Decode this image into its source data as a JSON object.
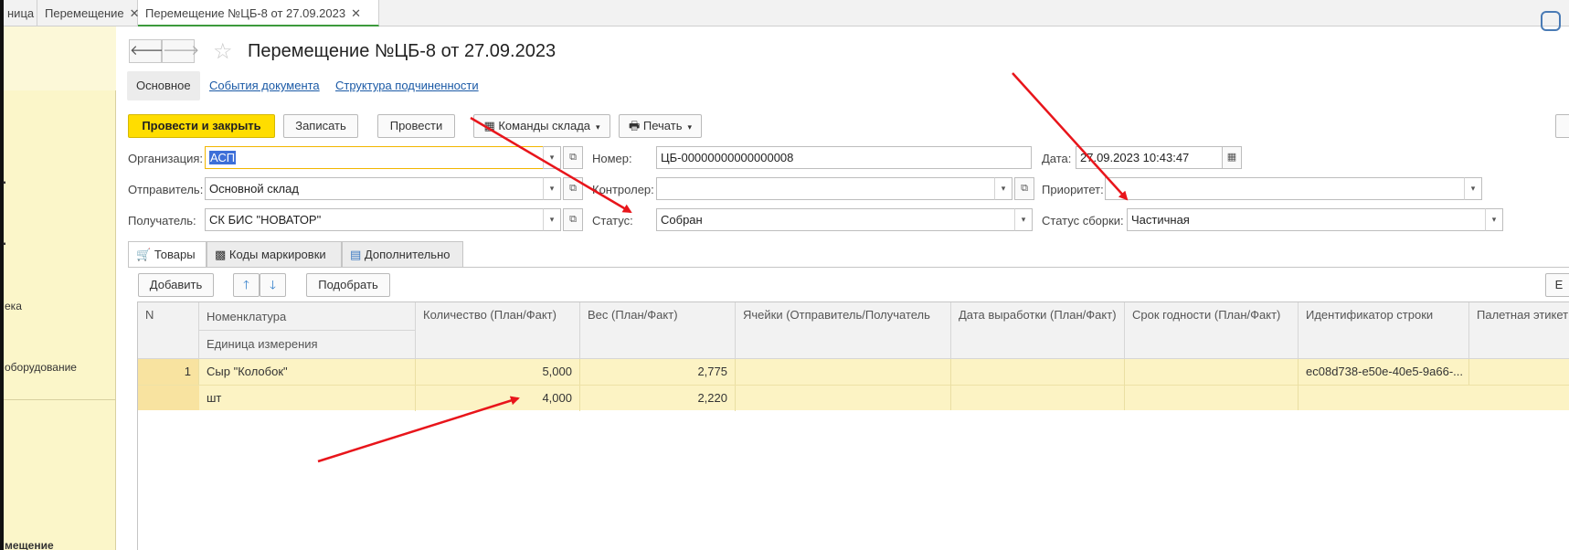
{
  "top_tabs": [
    {
      "label": "ница"
    },
    {
      "label": "Перемещение"
    },
    {
      "label": "Перемещение №ЦБ-8 от 27.09.2023"
    }
  ],
  "sidebar": {
    "items": [
      {
        "label": "ека"
      },
      {
        "label": "оборудование"
      },
      {
        "label": "мещение"
      }
    ]
  },
  "header": {
    "back_icon": "arrow-left-icon",
    "forward_icon": "arrow-right-icon",
    "favorite_icon": "star-icon",
    "title": "Перемещение №ЦБ-8 от 27.09.2023"
  },
  "subtabs": [
    {
      "label": "Основное"
    },
    {
      "label": "События документа"
    },
    {
      "label": "Структура подчиненности"
    }
  ],
  "toolbar": {
    "post_close": "Провести и закрыть",
    "write": "Записать",
    "post": "Провести",
    "warehouse_commands": "Команды склада",
    "print": "Печать"
  },
  "form": {
    "organization_label": "Организация:",
    "organization_value": "АСП",
    "sender_label": "Отправитель:",
    "sender_value": "Основной склад",
    "receiver_label": "Получатель:",
    "receiver_value": "СК БИС \"НОВАТОР\"",
    "number_label": "Номер:",
    "number_value": "ЦБ-00000000000000008",
    "controller_label": "Контролер:",
    "controller_value": "",
    "status_label": "Статус:",
    "status_value": "Собран",
    "date_label": "Дата:",
    "date_value": "27.09.2023 10:43:47",
    "priority_label": "Приоритет:",
    "priority_value": "",
    "assembly_status_label": "Статус сборки:",
    "assembly_status_value": "Частичная"
  },
  "inner_tabs": [
    {
      "label": "Товары"
    },
    {
      "label": "Коды маркировки"
    },
    {
      "label": "Дополнительно"
    }
  ],
  "table_toolbar": {
    "add": "Добавить",
    "pick": "Подобрать",
    "right_cut": "Е"
  },
  "table": {
    "headers": {
      "n": "N",
      "nomenclature": "Номенклатура",
      "unit": "Единица измерения",
      "qty": "Количество (План/Факт)",
      "weight": "Вес (План/Факт)",
      "cells": "Ячейки (Отправитель/Получатель",
      "prod_date": "Дата выработки (План/Факт)",
      "expiry": "Срок годности (План/Факт)",
      "row_id": "Идентификатор строки",
      "pallet": "Палетная этикет"
    },
    "rows": [
      {
        "n": "1",
        "nomenclature": "Сыр \"Колобок\"",
        "unit": "шт",
        "qty_plan": "5,000",
        "qty_fact": "4,000",
        "weight_plan": "2,775",
        "weight_fact": "2,220",
        "row_id": "ec08d738-e50e-40e5-9a66-..."
      }
    ]
  },
  "colors": {
    "primary_button": "#ffdd00",
    "sidebar_bg": "#fbf6c9",
    "selected_row": "#fcf3c4",
    "annotation_arrow": "#e8151b",
    "link": "#1b5aa6"
  }
}
